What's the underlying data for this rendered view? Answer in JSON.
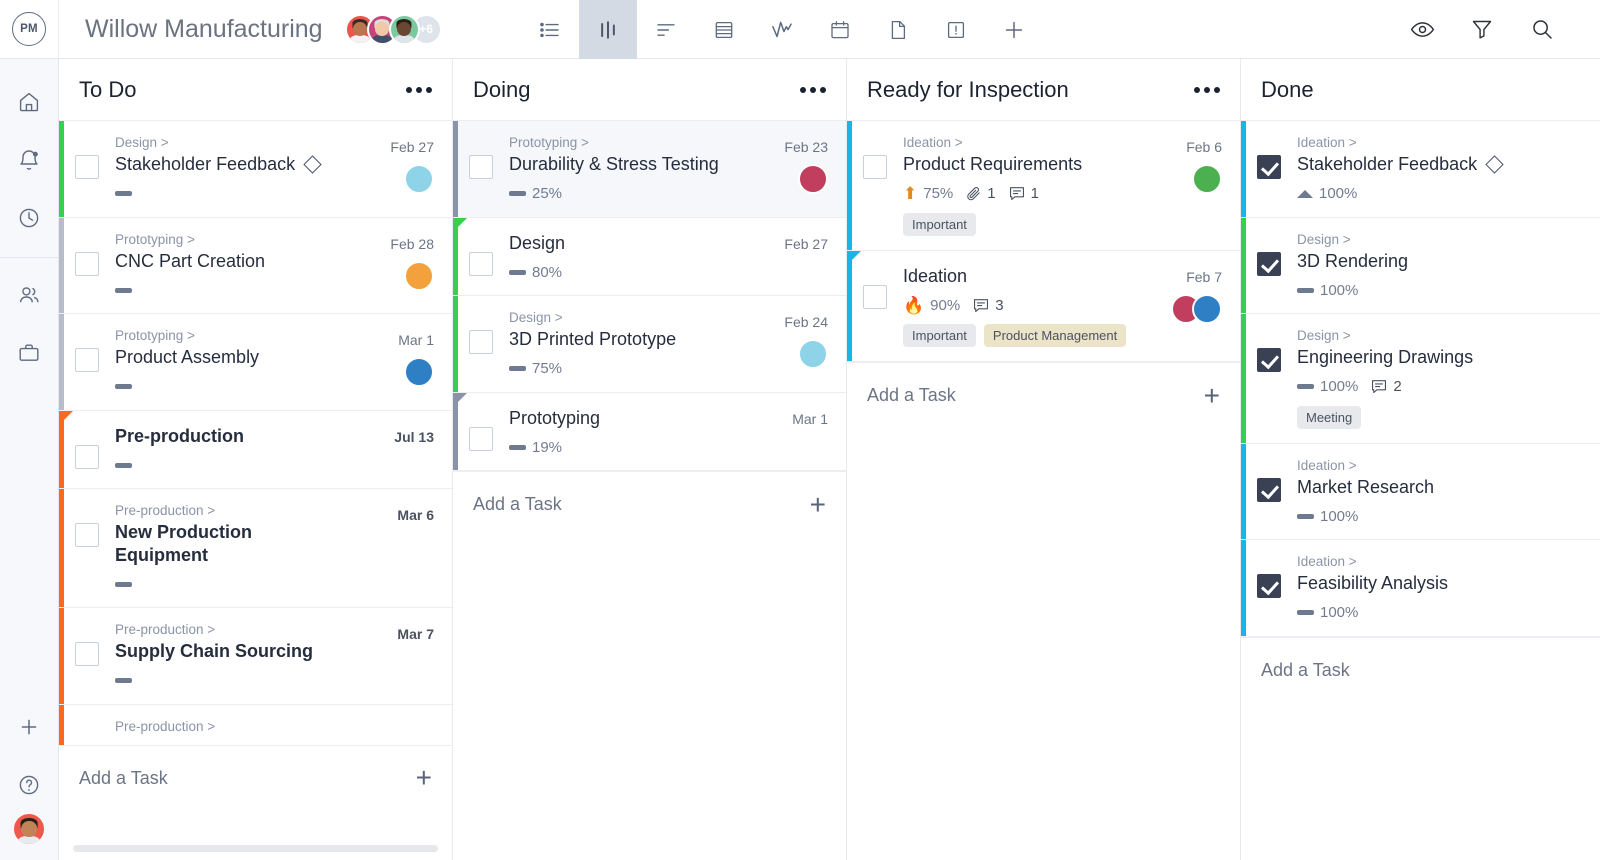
{
  "app": {
    "logo_text": "PM",
    "project_title": "Willow Manufacturing",
    "member_overflow": "+6"
  },
  "header_avatars": [
    {
      "name": "avatar-member-1",
      "ring": "#e8564e",
      "skin": "#b9764f",
      "hair": "#3b2a22",
      "body": "#f2f3f5"
    },
    {
      "name": "avatar-member-2",
      "ring": "#c6447c",
      "skin": "#f0c8a8",
      "hair": "#e0dbd4",
      "body": "#40506b"
    },
    {
      "name": "avatar-member-3",
      "ring": "#7cc9a0",
      "skin": "#6b4630",
      "hair": "#2b2018",
      "body": "#dfe5ea"
    }
  ],
  "view_tabs": [
    {
      "icon": "list-view-icon",
      "label": "List",
      "active": false
    },
    {
      "icon": "board-view-icon",
      "label": "Board",
      "active": true
    },
    {
      "icon": "gantt-view-icon",
      "label": "Gantt",
      "active": false
    },
    {
      "icon": "table-view-icon",
      "label": "Table",
      "active": false
    },
    {
      "icon": "chart-view-icon",
      "label": "Chart",
      "active": false
    },
    {
      "icon": "calendar-view-icon",
      "label": "Calendar",
      "active": false
    },
    {
      "icon": "page-view-icon",
      "label": "Pages",
      "active": false
    },
    {
      "icon": "issues-view-icon",
      "label": "Issues",
      "active": false
    },
    {
      "icon": "add-view-icon",
      "label": "Add view",
      "active": false
    }
  ],
  "header_actions": [
    {
      "icon": "eye-icon",
      "label": "Watch"
    },
    {
      "icon": "filter-icon",
      "label": "Filter"
    },
    {
      "icon": "search-icon",
      "label": "Search"
    }
  ],
  "sidebar": {
    "items": [
      {
        "icon": "home-icon",
        "label": "Home"
      },
      {
        "icon": "bell-icon",
        "label": "Notifications",
        "badge": true
      },
      {
        "icon": "clock-icon",
        "label": "Recents"
      },
      {
        "icon": "people-icon",
        "label": "People"
      },
      {
        "icon": "briefcase-icon",
        "label": "Projects"
      }
    ],
    "bottom": [
      {
        "icon": "plus-icon",
        "label": "Create"
      },
      {
        "icon": "help-icon",
        "label": "Help"
      }
    ],
    "user_avatar": {
      "name": "current-user-avatar",
      "ring": "#f0584c",
      "skin": "#c08458",
      "hair": "#2e2018",
      "body": "#e8eaee"
    }
  },
  "add_task_label": "Add a Task",
  "columns": [
    {
      "id": "todo",
      "title": "To Do",
      "has_scrollbar": true,
      "cards": [
        {
          "crumb": "Design >",
          "title": "Stakeholder Feedback",
          "milestone": true,
          "date": "Feb 27",
          "bold": false,
          "checked": false,
          "stripe": "#35d04c",
          "progress_icon": "dash",
          "percent": "",
          "attachments": "",
          "comments": "",
          "tags": [],
          "avatars": [
            {
              "name": "avatar-assignee",
              "ring": "#8ed3e8",
              "skin": "#f3cfae",
              "hair": "#c6316a",
              "body": "#f2c14e"
            }
          ]
        },
        {
          "crumb": "Prototyping >",
          "title": "CNC Part Creation",
          "milestone": false,
          "date": "Feb 28",
          "bold": false,
          "checked": false,
          "stripe": "#b6bdc9",
          "progress_icon": "dash",
          "percent": "",
          "attachments": "",
          "comments": "",
          "tags": [],
          "avatars": [
            {
              "name": "avatar-assignee",
              "ring": "#f2a13c",
              "skin": "#f7d9bd",
              "hair": "#f2a13c",
              "body": "#b8437f"
            }
          ]
        },
        {
          "crumb": "Prototyping >",
          "title": "Product Assembly",
          "milestone": false,
          "date": "Mar 1",
          "bold": false,
          "checked": false,
          "stripe": "#b6bdc9",
          "progress_icon": "dash",
          "percent": "",
          "attachments": "",
          "comments": "",
          "tags": [],
          "avatars": [
            {
              "name": "avatar-assignee",
              "ring": "#2f7fc4",
              "skin": "#c98a5c",
              "hair": "#2b1c12",
              "body": "#3d8f4e"
            }
          ]
        },
        {
          "crumb": "",
          "title": "Pre-production",
          "milestone": false,
          "date": "Jul 13",
          "bold": true,
          "checked": false,
          "stripe": "#fa6a1e",
          "stripe_notch": true,
          "progress_icon": "dash",
          "percent": "",
          "attachments": "",
          "comments": "",
          "tags": [],
          "avatars": []
        },
        {
          "crumb": "Pre-production >",
          "title": "New Production Equipment",
          "milestone": false,
          "date": "Mar 6",
          "bold": true,
          "checked": false,
          "stripe": "#fa6a1e",
          "progress_icon": "dash",
          "percent": "",
          "attachments": "",
          "comments": "",
          "tags": [],
          "avatars": []
        },
        {
          "crumb": "Pre-production >",
          "title": "Supply Chain Sourcing",
          "milestone": false,
          "date": "Mar 7",
          "bold": true,
          "checked": false,
          "stripe": "#fa6a1e",
          "progress_icon": "dash",
          "percent": "",
          "attachments": "",
          "comments": "",
          "tags": [],
          "avatars": []
        },
        {
          "crumb": "Pre-production >",
          "title": "",
          "milestone": false,
          "date": "",
          "bold": true,
          "checked": false,
          "stripe": "#fa6a1e",
          "clipped": true,
          "progress_icon": "",
          "percent": "",
          "attachments": "",
          "comments": "",
          "tags": [],
          "avatars": []
        }
      ]
    },
    {
      "id": "doing",
      "title": "Doing",
      "has_scrollbar": false,
      "cards": [
        {
          "crumb": "Prototyping >",
          "title": "Durability & Stress Testing",
          "milestone": false,
          "date": "Feb 23",
          "bold": false,
          "checked": false,
          "hovered": true,
          "stripe": "#8b94a6",
          "progress_icon": "dash",
          "percent": "25%",
          "attachments": "",
          "comments": "",
          "tags": [],
          "avatars": [
            {
              "name": "avatar-assignee",
              "ring": "#c23e5e",
              "skin": "#f0d3b6",
              "hair": "#e8e4de",
              "body": "#2f2a2a"
            }
          ]
        },
        {
          "crumb": "",
          "title": "Design",
          "milestone": false,
          "date": "Feb 27",
          "bold": false,
          "checked": false,
          "stripe": "#35d04c",
          "stripe_notch": true,
          "progress_icon": "dash",
          "percent": "80%",
          "attachments": "",
          "comments": "",
          "tags": [],
          "avatars": []
        },
        {
          "crumb": "Design >",
          "title": "3D Printed Prototype",
          "milestone": false,
          "date": "Feb 24",
          "bold": false,
          "checked": false,
          "stripe": "#35d04c",
          "progress_icon": "dash",
          "percent": "75%",
          "attachments": "",
          "comments": "",
          "tags": [],
          "avatars": [
            {
              "name": "avatar-assignee",
              "ring": "#8ed3e8",
              "skin": "#f3cfae",
              "hair": "#c6316a",
              "body": "#f2c14e"
            }
          ]
        },
        {
          "crumb": "",
          "title": "Prototyping",
          "milestone": false,
          "date": "Mar 1",
          "bold": false,
          "checked": false,
          "stripe": "#8b94a6",
          "stripe_notch": true,
          "progress_icon": "dash",
          "percent": "19%",
          "attachments": "",
          "comments": "",
          "tags": [],
          "avatars": []
        }
      ]
    },
    {
      "id": "ready-for-inspection",
      "title": "Ready for Inspection",
      "has_scrollbar": false,
      "cards": [
        {
          "crumb": "Ideation >",
          "title": "Product Requirements",
          "milestone": false,
          "date": "Feb 6",
          "bold": false,
          "checked": false,
          "stripe": "#19b5e8",
          "progress_icon": "arrow-up",
          "percent": "75%",
          "attachments": "1",
          "comments": "1",
          "tags": [
            {
              "label": "Important",
              "style": "gray"
            }
          ],
          "avatars": [
            {
              "name": "avatar-assignee",
              "ring": "#4cb050",
              "skin": "#c98a5c",
              "hair": "#2b1c12",
              "body": "#e4e7ec"
            }
          ]
        },
        {
          "crumb": "",
          "title": "Ideation",
          "milestone": false,
          "date": "Feb 7",
          "bold": false,
          "checked": false,
          "stripe": "#19b5e8",
          "stripe_notch": true,
          "progress_icon": "fire",
          "percent": "90%",
          "attachments": "",
          "comments": "3",
          "tags": [
            {
              "label": "Important",
              "style": "gray"
            },
            {
              "label": "Product Management",
              "style": "beige"
            }
          ],
          "avatars": [
            {
              "name": "avatar-assignee",
              "ring": "#c23e5e",
              "skin": "#f0d3b6",
              "hair": "#e8e4de",
              "body": "#2f2a2a"
            },
            {
              "name": "avatar-assignee",
              "ring": "#2f7fc4",
              "skin": "#c98a5c",
              "hair": "#2b1c12",
              "body": "#3d8f4e"
            }
          ]
        }
      ]
    },
    {
      "id": "done",
      "title": "Done",
      "has_scrollbar": false,
      "cards": [
        {
          "crumb": "Ideation >",
          "title": "Stakeholder Feedback",
          "milestone": true,
          "date": "",
          "bold": false,
          "checked": true,
          "stripe": "#19b5e8",
          "progress_icon": "triangle",
          "percent": "100%",
          "attachments": "",
          "comments": "",
          "tags": [],
          "avatars": []
        },
        {
          "crumb": "Design >",
          "title": "3D Rendering",
          "milestone": false,
          "date": "",
          "bold": false,
          "checked": true,
          "stripe": "#35d04c",
          "progress_icon": "dash",
          "percent": "100%",
          "attachments": "",
          "comments": "",
          "tags": [],
          "avatars": []
        },
        {
          "crumb": "Design >",
          "title": "Engineering Drawings",
          "milestone": false,
          "date": "",
          "bold": false,
          "checked": true,
          "stripe": "#35d04c",
          "progress_icon": "dash",
          "percent": "100%",
          "attachments": "",
          "comments": "2",
          "tags": [
            {
              "label": "Meeting",
              "style": "gray"
            }
          ],
          "avatars": []
        },
        {
          "crumb": "Ideation >",
          "title": "Market Research",
          "milestone": false,
          "date": "",
          "bold": false,
          "checked": true,
          "stripe": "#19b5e8",
          "progress_icon": "dash",
          "percent": "100%",
          "attachments": "",
          "comments": "",
          "tags": [],
          "avatars": []
        },
        {
          "crumb": "Ideation >",
          "title": "Feasibility Analysis",
          "milestone": false,
          "date": "",
          "bold": false,
          "checked": true,
          "stripe": "#19b5e8",
          "progress_icon": "dash",
          "percent": "100%",
          "attachments": "",
          "comments": "",
          "tags": [],
          "avatars": []
        }
      ]
    }
  ]
}
